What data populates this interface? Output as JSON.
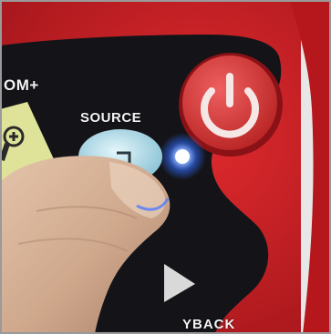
{
  "labels": {
    "zoom_plus": "OM+",
    "source": "SOURCE",
    "playback": "YBACK"
  },
  "colors": {
    "casing_red": "#cf1e22",
    "panel_black": "#141418",
    "power_button_red": "#d63a3a",
    "led_blue": "#2f6bff",
    "zoom_triangle_yellow": "#dfe39a",
    "source_button_cyan": "#a9d8e6",
    "skin_tone": "#cda98e"
  },
  "icons": {
    "power": "power-icon",
    "zoom": "magnifier-plus-icon",
    "source": "source-icon",
    "play": "play-triangle-icon"
  },
  "indicator": {
    "power_led_on": true
  }
}
